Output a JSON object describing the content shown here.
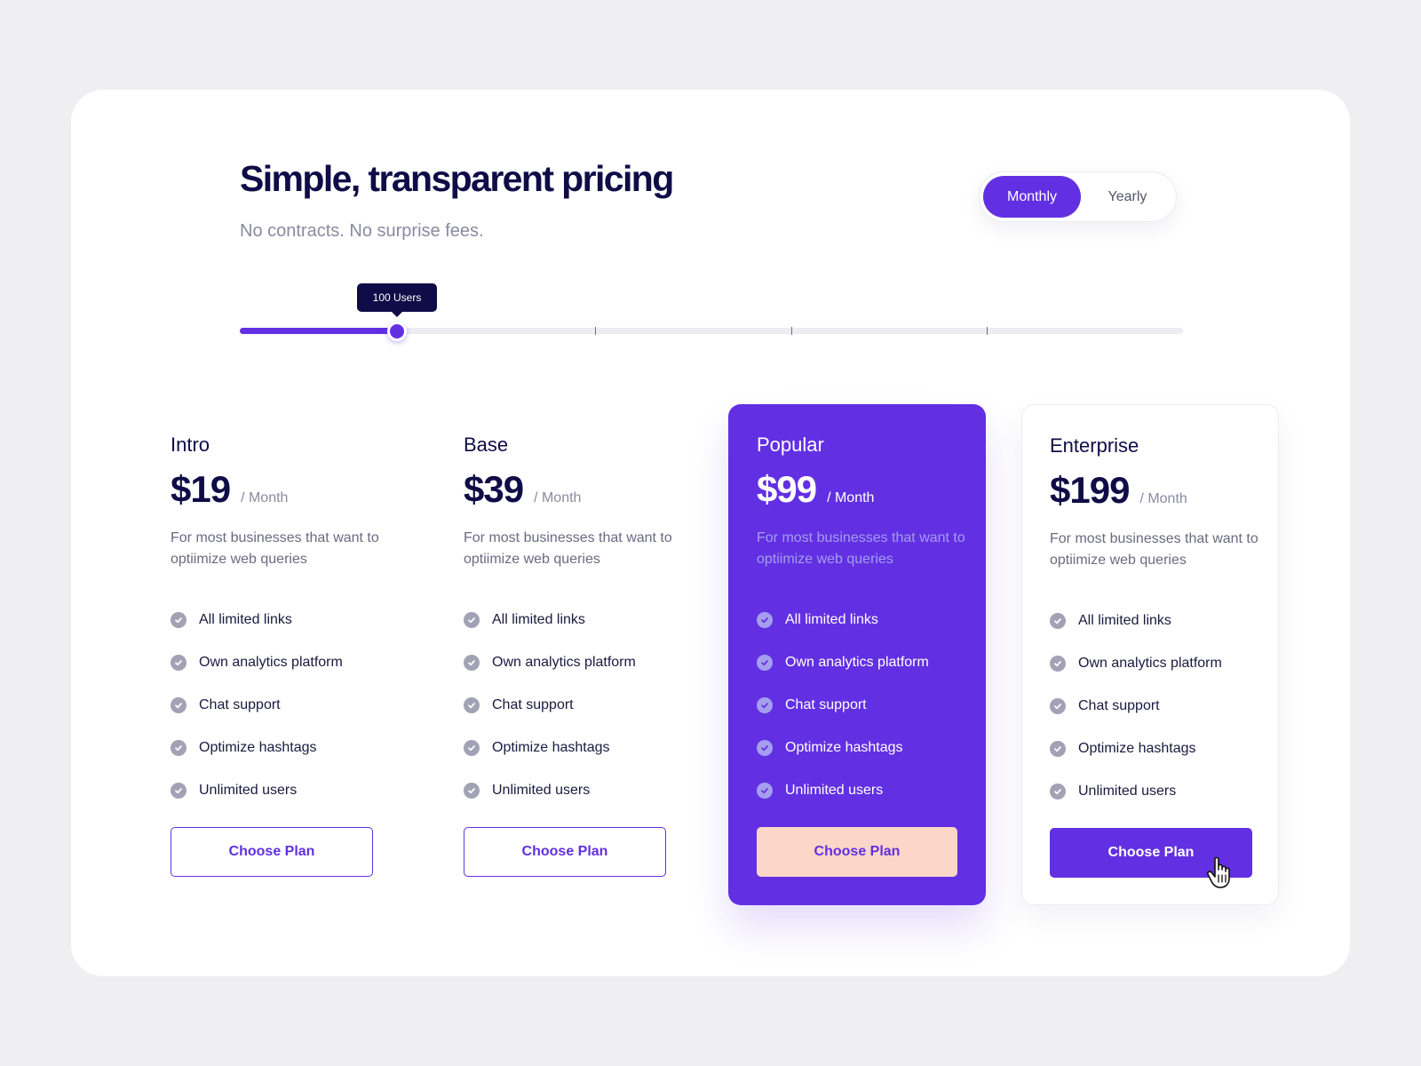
{
  "header": {
    "title": "Simple, transparent pricing",
    "subtitle": "No contracts. No surprise fees."
  },
  "billing_toggle": {
    "options": [
      "Monthly",
      "Yearly"
    ],
    "selected": "Monthly"
  },
  "users_slider": {
    "tooltip": "100 Users",
    "value_fraction": 0.167,
    "tick_fractions": [
      0.377,
      0.585,
      0.792
    ]
  },
  "colors": {
    "accent": "#6230e2",
    "heading": "#0f0c47",
    "popular_button": "#fcd6c9"
  },
  "plans": [
    {
      "name": "Intro",
      "price": "$19",
      "period": "/ Month",
      "description": "For most businesses that want to optiimize web queries",
      "features": [
        "All limited links",
        "Own analytics platform",
        "Chat support",
        "Optimize hashtags",
        "Unlimited users"
      ],
      "cta": "Choose Plan"
    },
    {
      "name": "Base",
      "price": "$39",
      "period": "/ Month",
      "description": "For most businesses that want to optiimize web queries",
      "features": [
        "All limited links",
        "Own analytics platform",
        "Chat support",
        "Optimize hashtags",
        "Unlimited users"
      ],
      "cta": "Choose Plan"
    },
    {
      "name": "Popular",
      "price": "$99",
      "period": "/ Month",
      "description": "For most businesses that want to optiimize web queries",
      "features": [
        "All limited links",
        "Own analytics platform",
        "Chat support",
        "Optimize hashtags",
        "Unlimited users"
      ],
      "cta": "Choose Plan"
    },
    {
      "name": "Enterprise",
      "price": "$199",
      "period": "/ Month",
      "description": "For most businesses that want to optiimize web queries",
      "features": [
        "All limited links",
        "Own analytics platform",
        "Chat support",
        "Optimize hashtags",
        "Unlimited users"
      ],
      "cta": "Choose Plan"
    }
  ],
  "icons": {
    "feature_check": "check-circle-icon",
    "pointer": "hand-pointer-cursor-icon"
  }
}
